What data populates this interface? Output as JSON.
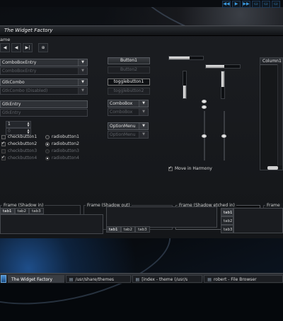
{
  "window": {
    "title": "The Widget Factory",
    "frame_label": "ame",
    "toolbar": [
      "◀",
      "◀",
      "▶|",
      "⊕"
    ]
  },
  "left": {
    "combo_entry": "ComboBoxEntry",
    "combo_entry_disabled": "ComboBoxEntry",
    "gtk_combo": "GtkCombo",
    "gtk_combo_disabled": "GtkCombo (Disabled)",
    "gtk_entry": "GtkEntry",
    "gtk_entry_disabled": "GtkEntry",
    "spin1_value": "1",
    "spin2_value": "0",
    "checkbuttons": [
      {
        "label": "checkbutton1",
        "checked": false,
        "disabled": false
      },
      {
        "label": "checkbutton2",
        "checked": true,
        "disabled": false
      },
      {
        "label": "checkbutton3",
        "checked": false,
        "disabled": true
      },
      {
        "label": "checkbutton4",
        "checked": true,
        "disabled": true
      }
    ],
    "radiobuttons": [
      {
        "label": "radiobutton1",
        "checked": false,
        "disabled": false
      },
      {
        "label": "radiobutton2",
        "checked": true,
        "disabled": false
      },
      {
        "label": "radiobutton3",
        "checked": false,
        "disabled": true
      },
      {
        "label": "radiobutton4",
        "checked": true,
        "disabled": true
      }
    ]
  },
  "middle": {
    "button1": "Button1",
    "button2": "Button2",
    "toggle1": "togglebutton1",
    "toggle2": "togglebutton2",
    "combobox": "ComboBox",
    "combobox_disabled": "ComboBox",
    "optionmenu": "OptionMenu",
    "optionmenu_disabled": "OptionMenu"
  },
  "scales": {
    "h1_fraction": 0.6,
    "h2_fraction": 0.55,
    "move_in_harmony": "Move in Harmony",
    "move_checked": true
  },
  "treeview": {
    "column": "Column1"
  },
  "frames": [
    {
      "label": "Frame (Shadow in)"
    },
    {
      "label": "Frame (Shadow out)"
    },
    {
      "label": "Frame (Shadow etched in)"
    },
    {
      "label": "Frame (Shadow etched out)"
    }
  ],
  "notebooks": {
    "top_tabs": [
      "tab1",
      "tab2",
      "tab3"
    ],
    "bottom_tabs": [
      "tab1",
      "tab2",
      "tab3"
    ],
    "right_tabs": [
      "tab1",
      "tab2",
      "tab3"
    ]
  },
  "taskbar": [
    {
      "label": "The Widget Factory",
      "active": true
    },
    {
      "label": "/usr/share/themes",
      "active": false
    },
    {
      "label": "[index - theme (/usr/s",
      "active": false
    },
    {
      "label": "robert - File Browser",
      "active": false
    }
  ],
  "topbar_controls": [
    "◀◀",
    "▶",
    "▶▶",
    "▭",
    "▭",
    "▭"
  ]
}
